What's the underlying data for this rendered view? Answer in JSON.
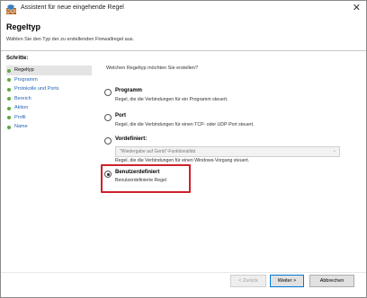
{
  "window": {
    "title": "Assistent für neue eingehende Regel",
    "close_glyph": "✕"
  },
  "header": {
    "title": "Regeltyp",
    "subtitle": "Wählen Sie den Typ der zu erstellenden Firewallregel aus."
  },
  "sidebar": {
    "title": "Schritte:",
    "items": [
      {
        "label": "Regeltyp",
        "active": true
      },
      {
        "label": "Programm"
      },
      {
        "label": "Protokolle und Ports"
      },
      {
        "label": "Bereich"
      },
      {
        "label": "Aktion"
      },
      {
        "label": "Profil"
      },
      {
        "label": "Name"
      }
    ]
  },
  "main": {
    "question": "Welchen Regeltyp möchten Sie erstellen?",
    "options": [
      {
        "label": "Programm",
        "desc": "Regel, die die Verbindungen für ein Programm steuert.",
        "checked": false
      },
      {
        "label": "Port",
        "desc": "Regel, die die Verbindungen für einen TCP- oder UDP-Port steuert.",
        "checked": false
      },
      {
        "label": "Vordefiniert:",
        "desc": "Regel, die die Verbindungen für einen Windows-Vorgang steuert.",
        "checked": false,
        "select_value": "\"Wiedergabe auf Gerät\"-Funktionalität"
      },
      {
        "label": "Benutzerdefiniert",
        "desc": "Benutzerdefinierte Regel",
        "checked": true
      }
    ]
  },
  "footer": {
    "back": "< Zurück",
    "next": "Weiter >",
    "cancel": "Abbrechen"
  },
  "colors": {
    "link": "#1f63b5",
    "step_dot": "#5ea93e",
    "highlight": "#d0202a"
  }
}
